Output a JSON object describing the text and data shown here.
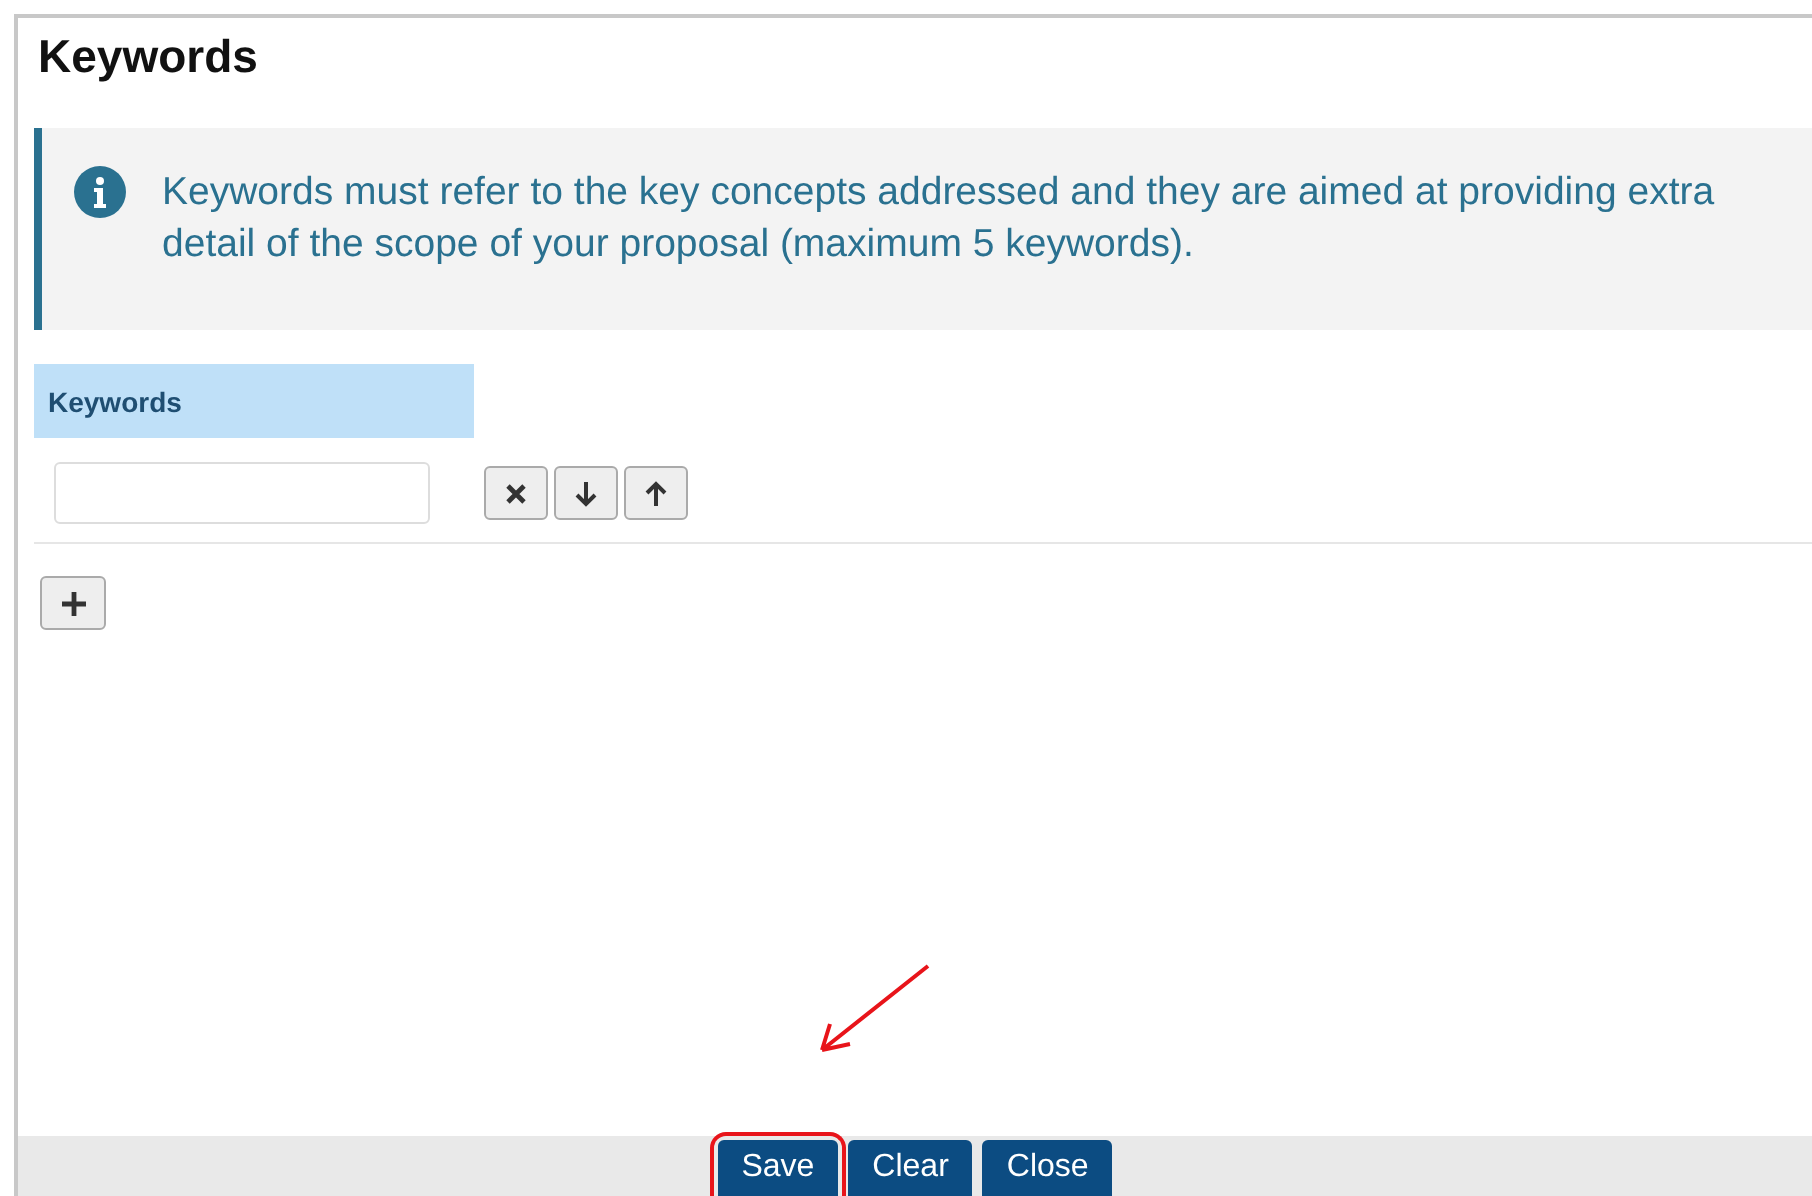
{
  "title": "Keywords",
  "info": {
    "text": "Keywords must refer to the key concepts addressed and they are aimed at providing extra detail of the scope of your proposal (maximum 5 keywords)."
  },
  "table": {
    "header": "Keywords",
    "rows": [
      {
        "value": ""
      }
    ]
  },
  "row_actions": [
    {
      "kind": "remove"
    },
    {
      "kind": "down"
    },
    {
      "kind": "up"
    }
  ],
  "footer_buttons": [
    {
      "label": "Save",
      "highlighted": true
    },
    {
      "label": "Clear",
      "highlighted": false
    },
    {
      "label": "Close",
      "highlighted": false
    }
  ]
}
